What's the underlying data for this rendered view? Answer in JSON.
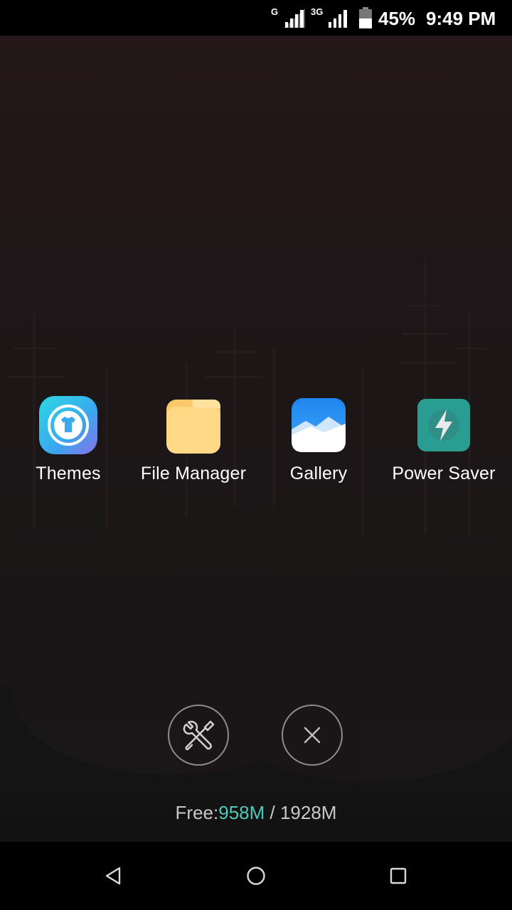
{
  "status_bar": {
    "network_1": "G",
    "network_2": "3G",
    "battery": "45%",
    "time": "9:49 PM",
    "icons": [
      "signal-icon",
      "signal-icon",
      "battery-icon"
    ]
  },
  "apps": [
    {
      "label": "Themes",
      "icon": "themes-icon",
      "color": "#2ec7e6"
    },
    {
      "label": "File Manager",
      "icon": "folder-icon",
      "color": "#fdd56e"
    },
    {
      "label": "Gallery",
      "icon": "gallery-icon",
      "color": "#2b8ff0"
    },
    {
      "label": "Power Saver",
      "icon": "power-saver-icon",
      "color": "#2a9d93"
    }
  ],
  "actions": {
    "tools_icon": "tools-icon",
    "close_icon": "close-icon"
  },
  "memory": {
    "prefix": "Free:",
    "free": "958M",
    "separator": " / ",
    "total": "1928M",
    "accent": "#4fc8be"
  },
  "nav": {
    "icons": [
      "back-icon",
      "home-icon",
      "recents-icon"
    ]
  }
}
